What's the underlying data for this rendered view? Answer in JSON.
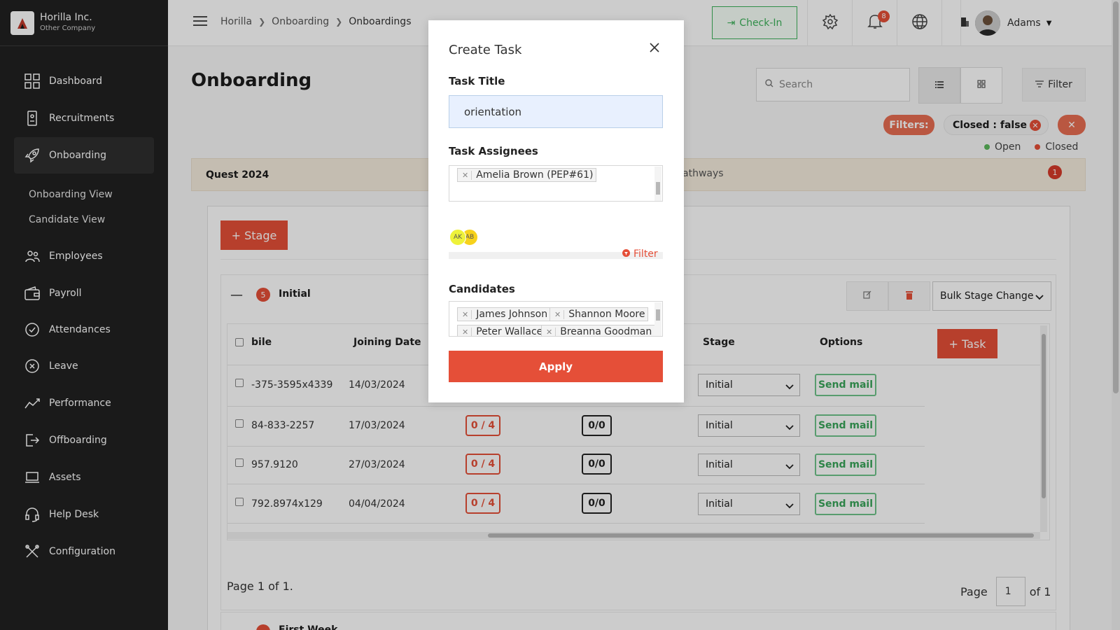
{
  "company": {
    "name": "Horilla Inc.",
    "subtitle": "Other Company"
  },
  "sidebar": {
    "items": [
      {
        "label": "Dashboard",
        "icon": "dashboard-icon"
      },
      {
        "label": "Recruitments",
        "icon": "recruitment-icon"
      },
      {
        "label": "Onboarding",
        "icon": "rocket-icon",
        "active": true
      },
      {
        "label": "Employees",
        "icon": "employees-icon"
      },
      {
        "label": "Payroll",
        "icon": "wallet-icon"
      },
      {
        "label": "Attendances",
        "icon": "check-circle-icon"
      },
      {
        "label": "Leave",
        "icon": "x-circle-icon"
      },
      {
        "label": "Performance",
        "icon": "chart-line-icon"
      },
      {
        "label": "Offboarding",
        "icon": "logout-icon"
      },
      {
        "label": "Assets",
        "icon": "laptop-icon"
      },
      {
        "label": "Help Desk",
        "icon": "headset-icon"
      },
      {
        "label": "Configuration",
        "icon": "tools-icon"
      }
    ],
    "subitems": [
      "Onboarding View",
      "Candidate View"
    ]
  },
  "topbar": {
    "breadcrumb": [
      "Horilla",
      "Onboarding",
      "Onboardings"
    ],
    "checkin": "Check-In",
    "notification_count": "8",
    "user": "Adams"
  },
  "main": {
    "title": "Onboarding",
    "search_placeholder": "Search",
    "filter_label": "Filter",
    "filters_label": "Filters:",
    "active_filter": "Closed : false",
    "legend": {
      "open": "Open",
      "closed": "Closed",
      "open_color": "#5cb85c",
      "closed_color": "#e54f38"
    },
    "recruitment": "Quest 2024",
    "recruitment_right": "athways",
    "recruitment_count": "1",
    "stage_button": "+ Stage",
    "stage": {
      "name": "Initial",
      "count": "5",
      "bulk_label": "Bulk Stage Change"
    },
    "task_button": "+ Task",
    "columns": [
      "bile",
      "Joining Date",
      "Stage",
      "Options"
    ],
    "rows": [
      {
        "mobile": "-375-3595x4339",
        "joining": "14/03/2024",
        "tasks": "",
        "docs": "",
        "stage": "Initial",
        "action": "Send mail"
      },
      {
        "mobile": "84-833-2257",
        "joining": "17/03/2024",
        "tasks": "0 / 4",
        "docs": "0/0",
        "stage": "Initial",
        "action": "Send mail"
      },
      {
        "mobile": "957.9120",
        "joining": "27/03/2024",
        "tasks": "0 / 4",
        "docs": "0/0",
        "stage": "Initial",
        "action": "Send mail"
      },
      {
        "mobile": "792.8974x129",
        "joining": "04/04/2024",
        "tasks": "0 / 4",
        "docs": "0/0",
        "stage": "Initial",
        "action": "Send mail"
      }
    ],
    "pagination": {
      "info": "Page 1 of 1.",
      "page_label": "Page",
      "page_value": "1",
      "of_label": "of 1"
    },
    "next_stage": "First Week"
  },
  "modal": {
    "title": "Create Task",
    "task_title_label": "Task Title",
    "task_title_value": "orientation",
    "assignees_label": "Task Assignees",
    "assignees": [
      "Amelia Brown (PEP#61)"
    ],
    "avatars": [
      "AK",
      "AB"
    ],
    "filter_link": "Filter",
    "candidates_label": "Candidates",
    "candidates": [
      "James Johnson",
      "Shannon Moore",
      "Peter Wallace",
      "Breanna Goodman"
    ],
    "apply": "Apply"
  }
}
